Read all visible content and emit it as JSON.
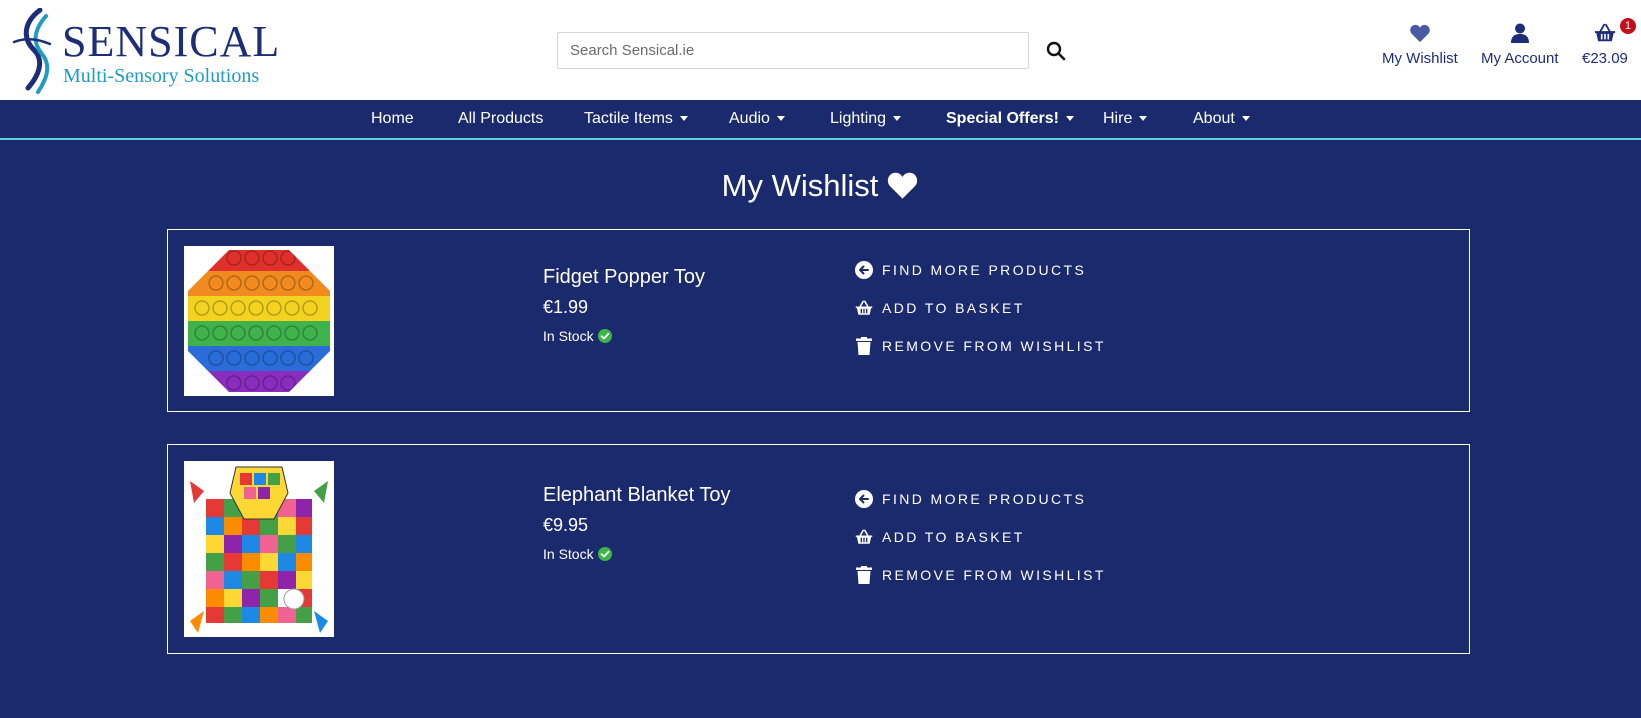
{
  "header": {
    "logo": {
      "title": "SENSICAL",
      "subtitle": "Multi-Sensory Solutions"
    },
    "search": {
      "placeholder": "Search Sensical.ie",
      "value": "",
      "button_icon": "search-icon"
    },
    "links": [
      {
        "label": "My Wishlist",
        "icon": "heart-icon"
      },
      {
        "label": "My Account",
        "icon": "user-icon"
      },
      {
        "label": "€23.09",
        "icon": "basket-icon",
        "badge": "1"
      }
    ]
  },
  "nav": {
    "items": [
      {
        "label": "Home",
        "dropdown": false
      },
      {
        "label": "All Products",
        "dropdown": false
      },
      {
        "label": "Tactile Items",
        "dropdown": true
      },
      {
        "label": "Audio",
        "dropdown": true
      },
      {
        "label": "Lighting",
        "dropdown": true
      },
      {
        "label": "Special Offers!",
        "dropdown": true
      },
      {
        "label": "Hire",
        "dropdown": true
      },
      {
        "label": "About",
        "dropdown": true
      }
    ]
  },
  "main": {
    "title": "My Wishlist",
    "items": [
      {
        "name": "Fidget Popper Toy",
        "price": "€1.99",
        "stock": "In Stock",
        "image": "rainbow-octagon-popper"
      },
      {
        "name": "Elephant Blanket Toy",
        "price": "€9.95",
        "stock": "In Stock",
        "image": "patchwork-elephant-blanket"
      }
    ],
    "actions": {
      "find_more": "Find More Products",
      "add_to_basket": "Add to Basket",
      "remove": "Remove from Wishlist"
    }
  },
  "colors": {
    "background": "#1a2a6c",
    "accent_line": "#5fd1e2",
    "brand_navy": "#1e2d78",
    "brand_teal": "#1e9cc3",
    "badge": "#c0101a",
    "stock_ok": "#3bb54a"
  }
}
